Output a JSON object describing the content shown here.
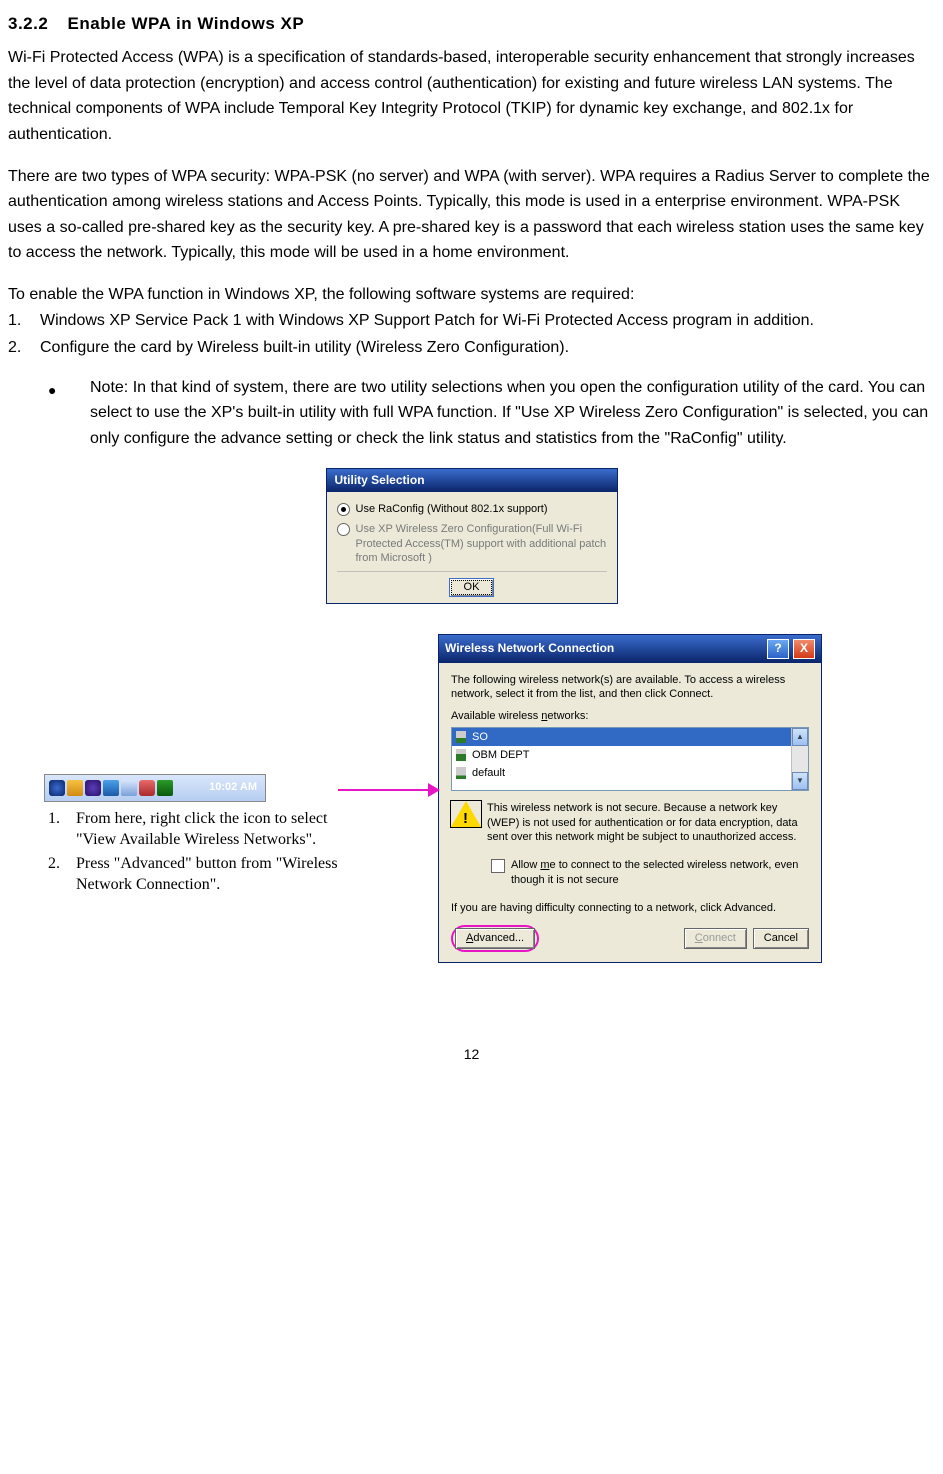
{
  "heading": {
    "number": "3.2.2",
    "title": "Enable WPA in Windows XP"
  },
  "para1": "Wi-Fi Protected Access (WPA) is a specification of standards-based, interoperable security enhancement that strongly increases the level of data protection (encryption) and access control (authentication) for existing and future wireless LAN systems. The technical components of WPA include Temporal Key Integrity Protocol (TKIP) for dynamic key exchange, and 802.1x for authentication.",
  "para2": "There are two types of WPA security: WPA-PSK (no server) and WPA (with server). WPA requires a Radius Server to complete the authentication among wireless stations and Access Points. Typically, this mode is used in a enterprise environment. WPA-PSK uses a so-called pre-shared key as the security key. A pre-shared key is a password that each wireless station uses the same key to access the network. Typically, this mode will be used in a home environment.",
  "lead": "To enable the WPA function in Windows XP, the following software systems are required:",
  "req": [
    "Windows XP Service Pack 1 with Windows XP Support Patch for Wi-Fi Protected Access program in addition.",
    "Configure the card by Wireless built-in utility (Wireless Zero Configuration)."
  ],
  "note": "Note: In that kind of system, there are two utility selections when you open the configuration utility of the card. You can select to use the XP's built-in utility with full WPA function. If \"Use XP Wireless Zero Configuration\" is selected, you can only configure the advance setting or check the link status and statistics from the \"RaConfig\" utility.",
  "util": {
    "title": "Utility Selection",
    "opt1": "Use RaConfig (Without 802.1x support)",
    "opt2": "Use XP Wireless Zero Configuration(Full Wi-Fi Protected Access(TM) support with additional patch from Microsoft )",
    "ok": "OK"
  },
  "tray_time": "10:02 AM",
  "steps": [
    "From here, right click the icon to select \"View Available Wireless Networks\".",
    "Press \"Advanced\" button from \"Wireless Network Connection\"."
  ],
  "wnc": {
    "title": "Wireless Network Connection",
    "intro": "The following wireless network(s) are available. To access a wireless network, select it from the list, and then click Connect.",
    "avail_label": "Available wireless networks:",
    "items": [
      "SO",
      "OBM DEPT",
      "default"
    ],
    "warn": "This wireless network is not secure. Because a network key (WEP) is not used for authentication or for data encryption, data sent over this network might be subject to unauthorized access.",
    "allow": "Allow me to connect to the selected wireless network, even though it is not secure",
    "difficulty": "If you are having difficulty connecting to a network, click Advanced.",
    "advanced": "Advanced...",
    "connect": "Connect",
    "cancel": "Cancel"
  },
  "page": "12"
}
